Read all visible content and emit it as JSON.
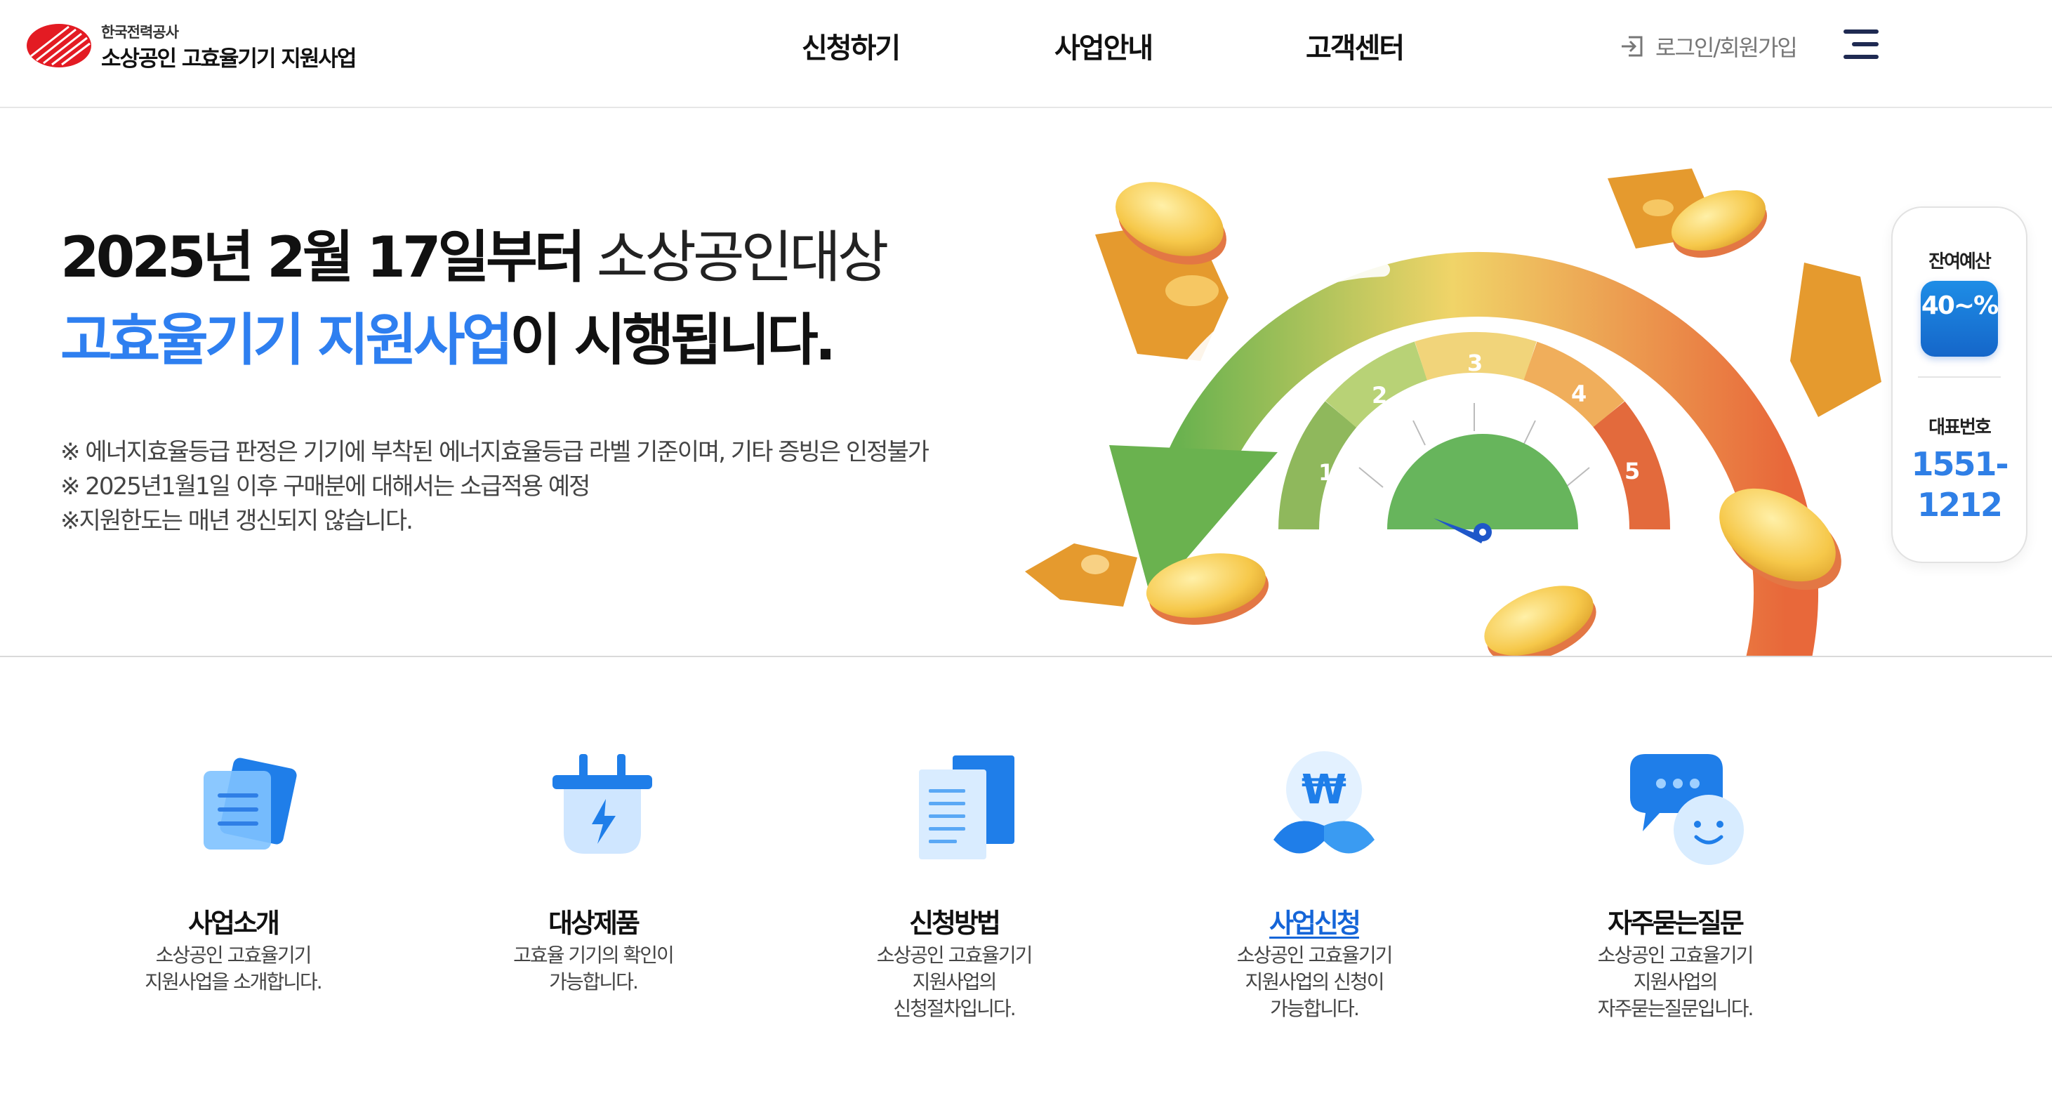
{
  "header": {
    "org": "한국전력공사",
    "site_name": "소상공인 고효율기기 지원사업",
    "nav": [
      "신청하기",
      "사업안내",
      "고객센터"
    ],
    "login": "로그인/회원가입",
    "menu_icon": "hamburger-menu-icon",
    "brand_color": "#e31b23"
  },
  "hero": {
    "line1_bold": "2025년 2월 17일부터",
    "line1_light": "소상공인대상",
    "line2_blue": "고효율기기 지원사업",
    "line2_rest": "이 시행됩니다.",
    "notes": [
      "※ 에너지효율등급 판정은 기기에 부착된 에너지효율등급 라벨 기준이며, 기타 증빙은 인정불가",
      "※ 2025년1월1일 이후 구매분에 대해서는 소급적용 예정",
      "※지원한도는 매년 갱신되지 않습니다."
    ],
    "gauge_grades": [
      "1",
      "2",
      "3",
      "4",
      "5"
    ],
    "accent_color": "#2e7ff0"
  },
  "side_panel": {
    "budget_label": "잔여예산",
    "budget_value": "40~%",
    "phone_label": "대표번호",
    "phone_part1": "1551-",
    "phone_part2": "1212",
    "phone_color": "#2f7fe6"
  },
  "services": [
    {
      "title": "사업소개",
      "desc": "소상공인 고효율기기\n지원사업을 소개합니다.",
      "icon": "document-stack-icon",
      "active": false
    },
    {
      "title": "대상제품",
      "desc": "고효율 기기의 확인이\n가능합니다.",
      "icon": "plug-lightning-icon",
      "active": false
    },
    {
      "title": "신청방법",
      "desc": "소상공인 고효율기기\n지원사업의\n신청절차입니다.",
      "icon": "documents-icon",
      "active": false
    },
    {
      "title": "사업신청",
      "desc": "소상공인 고효율기기\n지원사업의 신청이\n가능합니다.",
      "icon": "won-sprout-icon",
      "active": true
    },
    {
      "title": "자주묻는질문",
      "desc": "소상공인 고효율기기\n지원사업의\n자주묻는질문입니다.",
      "icon": "chat-bubbles-icon",
      "active": false
    }
  ]
}
